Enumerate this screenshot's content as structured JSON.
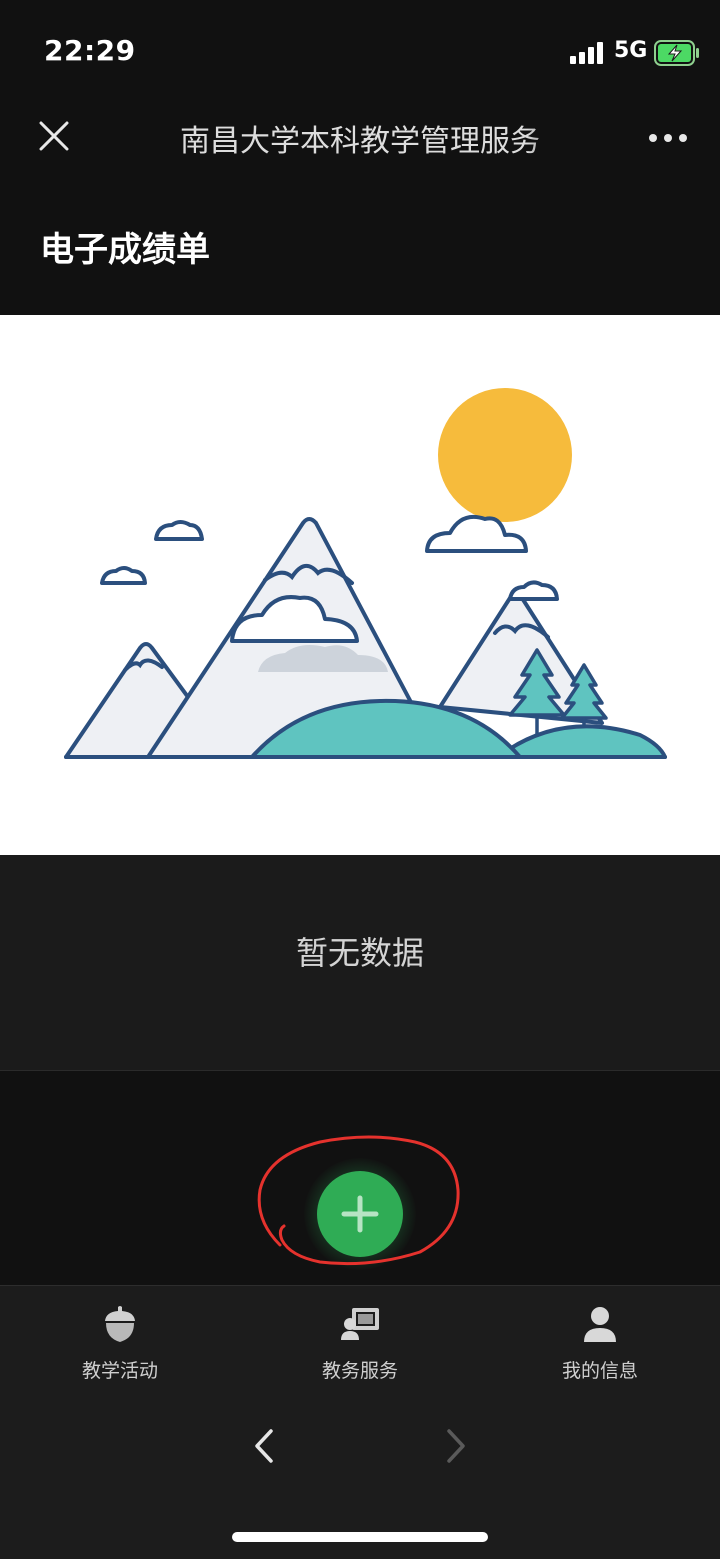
{
  "status_bar": {
    "time": "22:29",
    "network": "5G",
    "icons": [
      "signal-icon",
      "battery-charging-icon"
    ]
  },
  "nav_bar": {
    "title": "南昌大学本科教学管理服务",
    "close_icon": "close-icon",
    "more_icon": "more-icon"
  },
  "page": {
    "title": "电子成绩单"
  },
  "illustration": {
    "icon": "mountain-landscape-illustration",
    "colors": {
      "sun": "#F6BB3C",
      "hill": "#5FC4C0",
      "outline": "#2B4F7E",
      "snow": "#EEF0F4"
    }
  },
  "empty_state": {
    "text": "暂无数据"
  },
  "add_button": {
    "icon": "plus-icon",
    "color": "#2FAC55",
    "annotation_color": "#E5322D"
  },
  "tab_bar": {
    "items": [
      {
        "label": "教学活动",
        "icon": "acorn-icon"
      },
      {
        "label": "教务服务",
        "icon": "teacher-board-icon"
      },
      {
        "label": "我的信息",
        "icon": "user-icon"
      }
    ]
  },
  "toolbar": {
    "back_icon": "chevron-left-icon",
    "forward_icon": "chevron-right-icon"
  }
}
